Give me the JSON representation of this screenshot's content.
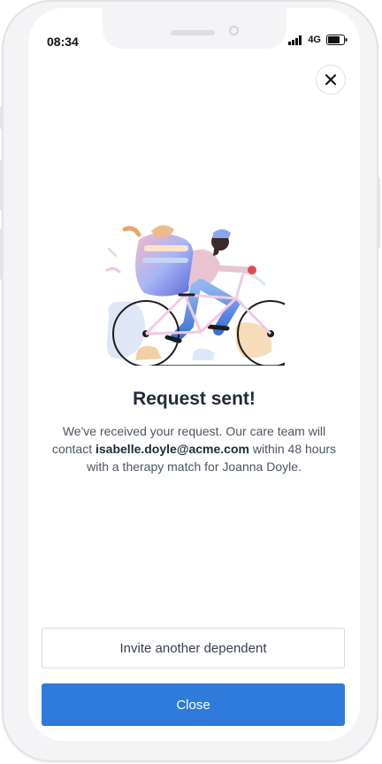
{
  "status_bar": {
    "time": "08:34",
    "network": "4G"
  },
  "modal": {
    "close_icon": "close-icon",
    "illustration": "cyclist-delivery-illustration",
    "title": "Request sent!",
    "message_part1": "We've received your request. Our care team will contact ",
    "email": "isabelle.doyle@acme.com",
    "message_part2": " within 48 hours with a therapy match for Joanna Doyle."
  },
  "actions": {
    "invite_label": "Invite another dependent",
    "close_label": "Close"
  },
  "colors": {
    "primary": "#2f7bdc",
    "heading": "#1f2937",
    "body": "#4b5563"
  }
}
